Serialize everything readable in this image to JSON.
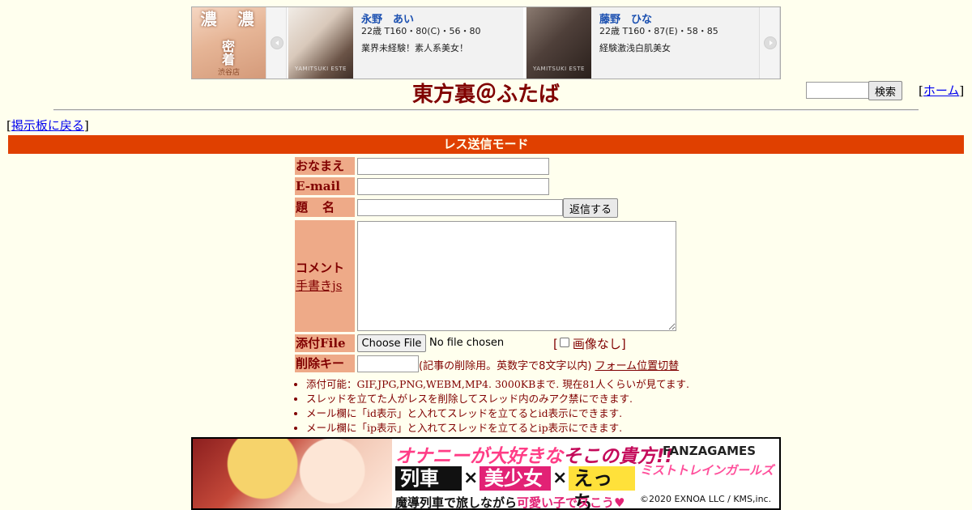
{
  "top_ad": {
    "shop_banner": {
      "text_1": "濃",
      "text_2": "濃",
      "text_3": "密着",
      "location": "渋谷店"
    },
    "cards": [
      {
        "name": "永野　あい",
        "spec": "22歳 T160・80(C)・56・80",
        "description": "業界未経験！素人系美女！",
        "photo_watermark": "YAMITSUKI ESTE"
      },
      {
        "name": "藤野　ひな",
        "spec": "22歳 T160・87(E)・58・85",
        "description": "経験激浅白肌美女",
        "photo_watermark": "YAMITSUKI ESTE"
      }
    ],
    "icons": {
      "prev": "chevron-left-icon",
      "next": "chevron-right-icon"
    }
  },
  "header": {
    "site_title": "東方裏＠ふたば",
    "search_button": "検索",
    "search_value": "",
    "home_link": "ホーム",
    "back_link": "掲示板に戻る"
  },
  "mode_bar": {
    "label": "レス送信モード"
  },
  "form": {
    "name_label": "おなまえ",
    "email_label": "E-mail",
    "subject_label": "題名",
    "reply_button": "返信する",
    "comment_label": "コメント",
    "handwriting_link": "手書きjs",
    "file_label": "添付File",
    "file_button": "Choose File",
    "file_status": "No file chosen",
    "no_image_label": "画像なし",
    "delete_key_label": "削除キー",
    "delete_key_note": "(記事の削除用。英数字で8文字以内)",
    "form_position_link": "フォーム位置切替",
    "values": {
      "name": "",
      "email": "",
      "subject": "",
      "comment": "",
      "delete_key": ""
    }
  },
  "notes": [
    "添付可能：GIF,JPG,PNG,WEBM,MP4. 3000KBまで. 現在81人くらいが見てます.",
    "スレッドを立てた人がレスを削除してスレッド内のみアク禁にできます.",
    "メール欄に「id表示」と入れてスレッドを立てるとid表示にできます.",
    "メール欄に「ip表示」と入れてスレッドを立てるとip表示にできます."
  ],
  "bottom_banner": {
    "headline_part1": "オナニーが大好きな",
    "headline_part2": "そこの貴方!!",
    "word_1": "列車",
    "word_2": "美少女",
    "word_3": "えっち",
    "times_1": "×",
    "times_2": "×",
    "tagline_part1": "魔導列車で旅しながら",
    "tagline_part2": "可愛い子でヌこう♥",
    "publisher": "FANZAGAMES",
    "game_title": "ミストトレインガールズ",
    "copyright": "©2020 EXNOA LLC / KMS,inc."
  },
  "colors": {
    "background": "#ffffee",
    "text": "#800000",
    "mode_bar": "#e04000",
    "label_bg": "#eeaa88",
    "link": "#0000ee"
  }
}
